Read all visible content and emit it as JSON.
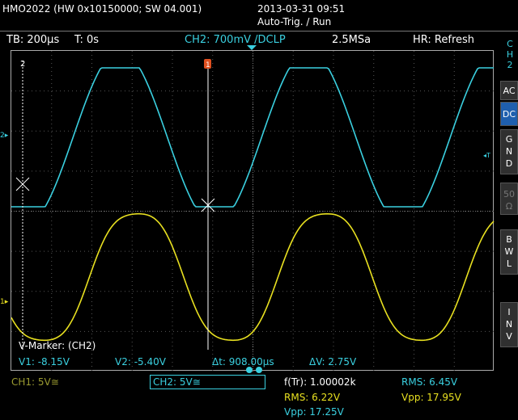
{
  "header": {
    "device": "HMO2022 (HW 0x10150000; SW 04.001)",
    "datetime": "2013-03-31 09:51",
    "trigger_status": "Auto-Trig. / Run"
  },
  "infobar": {
    "timebase": "TB: 200µs",
    "trigger_time": "T: 0s",
    "ch2_setting": "CH2: 700mV /DCLP",
    "sample_rate": "2.5MSa",
    "hr_mode": "HR: Refresh"
  },
  "sidebar": {
    "channel": [
      "C",
      "H",
      "2"
    ],
    "buttons": [
      {
        "label": [
          "A",
          "C"
        ],
        "state": "normal"
      },
      {
        "label": [
          "D",
          "C"
        ],
        "state": "active"
      },
      {
        "label": [
          "G",
          "N",
          "D"
        ],
        "state": "normal"
      },
      {
        "label": [
          "50",
          "Ω"
        ],
        "state": "disabled"
      },
      {
        "label": [
          "B",
          "W",
          "L"
        ],
        "state": "normal"
      },
      {
        "label": [
          "I",
          "N",
          "V"
        ],
        "state": "normal"
      }
    ]
  },
  "markers": {
    "cursor1_label": "2",
    "cursor2_label": "1",
    "title": "V-Marker: (CH2)",
    "v1": "V1: -8.15V",
    "v2": "V2: -5.40V",
    "dt": "Δt: 908.00µs",
    "dv": "ΔV: 2.75V"
  },
  "screen_labels": {
    "ch2_ground": "2",
    "ch1_ground": "1",
    "trigger_level": "T"
  },
  "footer": {
    "ch1": "CH1: 5V≅",
    "ch2": "CH2: 5V≅",
    "freq": "f(Tr): 1.00002k",
    "rms_ch2": "RMS: 6.45V",
    "rms_ch1": "RMS: 6.22V",
    "vpp_ch2": "Vpp: 17.95V",
    "vpp_ch1": "Vpp: 17.25V"
  },
  "colors": {
    "ch1": "#e8e020",
    "ch2": "#3ad0e0",
    "grid": "#555555",
    "marker": "#ffffff",
    "trigger_marker": "#e05020",
    "active_button": "#1f5fae"
  }
}
